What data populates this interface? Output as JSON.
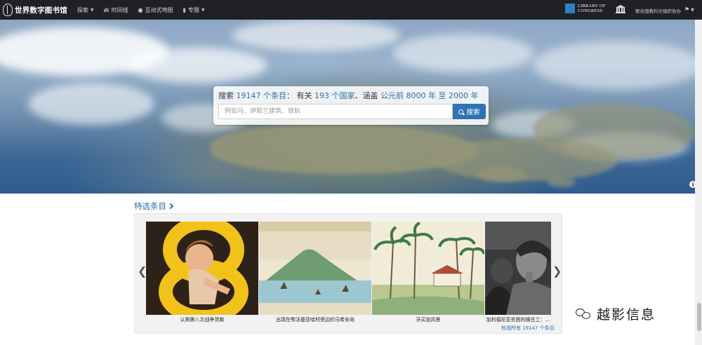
{
  "nav": {
    "logo_text": "世界数字图书馆",
    "items": [
      {
        "label": "探索",
        "icon": "none",
        "has_caret": true
      },
      {
        "label": "时间线",
        "icon": "bar-chart-icon",
        "has_caret": false
      },
      {
        "label": "互动式地图",
        "icon": "globe-icon",
        "has_caret": false
      },
      {
        "label": "专题",
        "icon": "book-icon",
        "has_caret": true
      }
    ],
    "partner_line1": "LIBRARY OF",
    "partner_line2": "CONGRESS",
    "unesco_label": "联合国教科文组织协办",
    "flag_icon": "flag-icon"
  },
  "search": {
    "prefix": "搜索",
    "count": "19147 个条目",
    "mid1": "：  有关",
    "countries": "193 个国家",
    "mid2": "、涵盖",
    "range": "公元前 8000 年 至 2000 年",
    "placeholder": "例如马、伊斯兰建筑、铁轨",
    "button_label": "搜索"
  },
  "featured": {
    "title": "特选条目",
    "items": [
      {
        "caption": "认购第八次战争贷款"
      },
      {
        "caption": "出现在鄂法基亚哈村旁边的马希安岛"
      },
      {
        "caption": "牙买加风景"
      },
      {
        "caption": "加利福尼亚贫困的摘豆工：…"
      }
    ],
    "view_all": "检视所有 19147 个条目"
  },
  "watermark": {
    "text": "越影信息"
  },
  "colors": {
    "accent": "#2a6fae",
    "nav_bg": "#1f2124",
    "button": "#2e73b5"
  }
}
